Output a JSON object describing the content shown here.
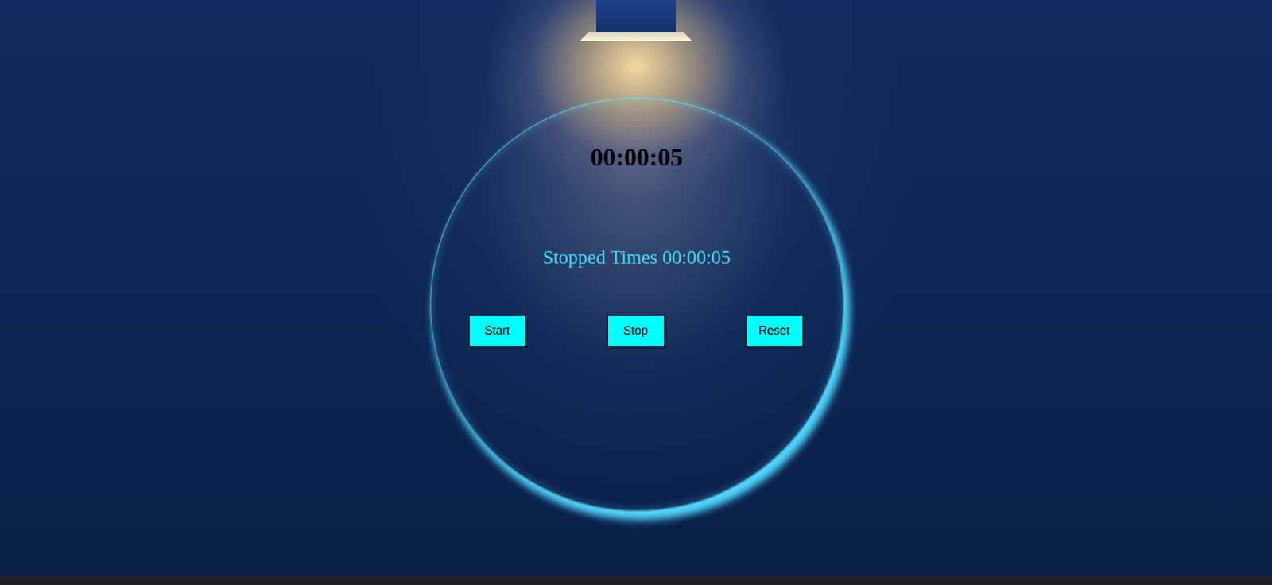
{
  "timer": {
    "display": "00:00:05"
  },
  "stopped": {
    "label": "Stopped Times 00:00:05"
  },
  "buttons": [
    "Start",
    "Stop",
    "Reset"
  ]
}
